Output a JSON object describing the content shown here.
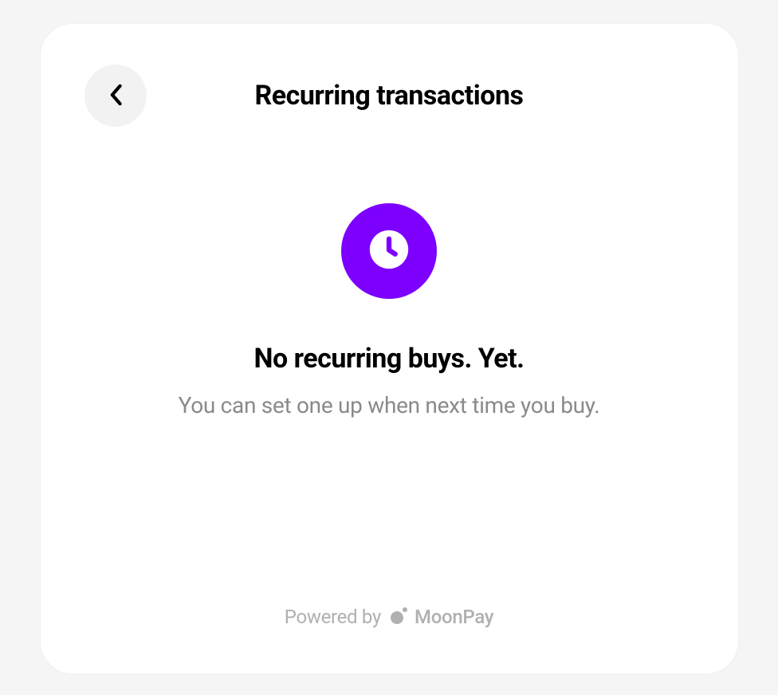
{
  "header": {
    "title": "Recurring transactions"
  },
  "empty_state": {
    "title": "No recurring buys. Yet.",
    "subtitle": "You can set one up when next time you buy."
  },
  "footer": {
    "powered_by": "Powered by",
    "brand": "MoonPay"
  },
  "colors": {
    "accent": "#7d00ff"
  }
}
